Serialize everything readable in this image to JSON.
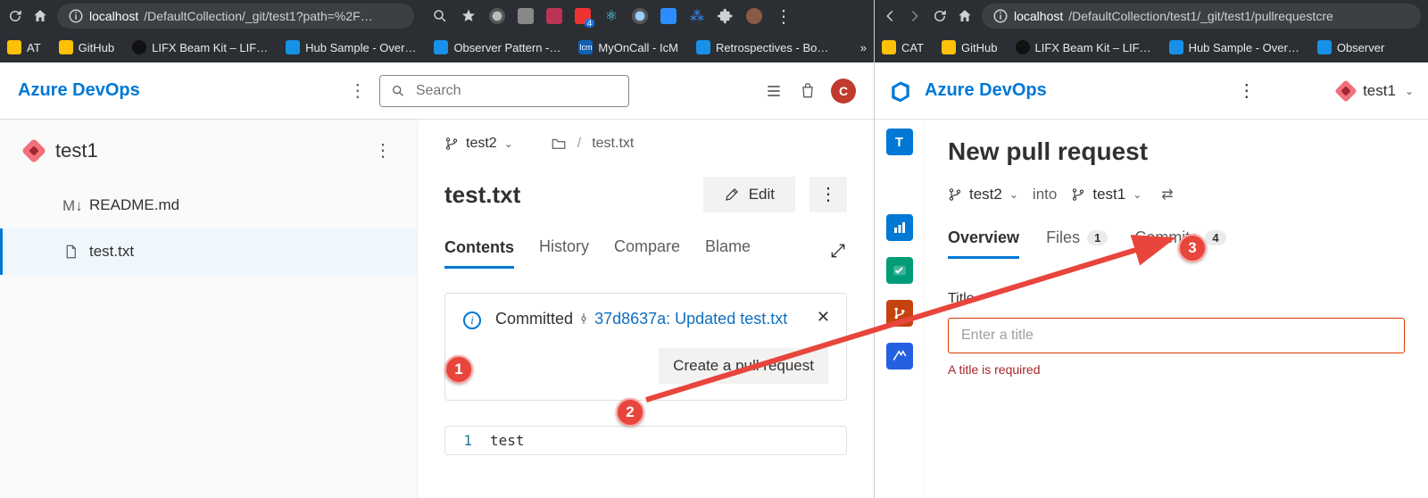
{
  "left": {
    "chrome": {
      "url_host": "localhost",
      "url_path": "/DefaultCollection/_git/test1?path=%2F…",
      "bookmarks": [
        "AT",
        "GitHub",
        "LIFX Beam Kit – LIF…",
        "Hub Sample - Over…",
        "Observer Pattern -…",
        "MyOnCall - IcM",
        "Retrospectives - Bo…"
      ]
    },
    "header": {
      "brand": "Azure DevOps",
      "search_placeholder": "Search",
      "avatar_letter": "C"
    },
    "sidebar": {
      "repo": "test1",
      "readme": "README.md",
      "file": "test.txt"
    },
    "main": {
      "branch": "test2",
      "crumb_file": "test.txt",
      "file_title": "test.txt",
      "edit_label": "Edit",
      "tabs": [
        "Contents",
        "History",
        "Compare",
        "Blame"
      ],
      "info_committed_label": "Committed",
      "info_commit": "37d8637a: Updated test.txt",
      "info_pr_label": "Create a pull request",
      "code_line_no": "1",
      "code_line": "test"
    }
  },
  "right": {
    "chrome": {
      "url_host": "localhost",
      "url_path": "/DefaultCollection/test1/_git/test1/pullrequestcre",
      "bookmarks": [
        "CAT",
        "GitHub",
        "LIFX Beam Kit – LIF…",
        "Hub Sample - Over…",
        "Observer"
      ]
    },
    "header": {
      "brand": "Azure DevOps",
      "repo": "test1"
    },
    "main": {
      "page_title": "New pull request",
      "src_branch": "test2",
      "into_label": "into",
      "dst_branch": "test1",
      "tabs": {
        "overview": "Overview",
        "files": "Files",
        "files_count": "1",
        "commits": "Commits",
        "commits_count": "4"
      },
      "title_label": "Title",
      "title_placeholder": "Enter a title",
      "title_error": "A title is required"
    }
  },
  "annotations": {
    "one": "1",
    "two": "2",
    "three": "3"
  }
}
